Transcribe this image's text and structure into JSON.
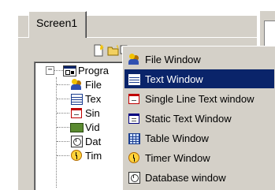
{
  "tabs": [
    {
      "label": "Screen1"
    }
  ],
  "toolbar": {
    "icons": [
      "new-icon",
      "open-icon",
      "copy-icon",
      "paste-icon",
      "delete-icon",
      "move-up-icon",
      "check-icon"
    ]
  },
  "tree": {
    "expander": "−",
    "root_label": "Progra",
    "children": [
      {
        "label": "File",
        "icon": "people-icon"
      },
      {
        "label": "Tex",
        "icon": "table-icon"
      },
      {
        "label": "Sin",
        "icon": "single-line-text-icon"
      },
      {
        "label": "Vid",
        "icon": "video-icon"
      },
      {
        "label": "Dat",
        "icon": "database-icon"
      },
      {
        "label": "Tim",
        "icon": "timer-icon"
      }
    ]
  },
  "context_menu": {
    "items": [
      {
        "label": "File Window",
        "icon": "people-icon"
      },
      {
        "label": "Text Window",
        "icon": "table-icon",
        "selected": true
      },
      {
        "label": "Single Line Text window",
        "icon": "single-line-text-icon"
      },
      {
        "label": "Static Text Window",
        "icon": "static-text-icon"
      },
      {
        "label": "Table Window",
        "icon": "table-window-icon"
      },
      {
        "label": "Timer Window",
        "icon": "timer-icon"
      },
      {
        "label": "Database window",
        "icon": "database-icon"
      }
    ]
  },
  "colors": {
    "face": "#d4d0c8",
    "selection": "#0a246a",
    "selection_text": "#ffffff"
  }
}
